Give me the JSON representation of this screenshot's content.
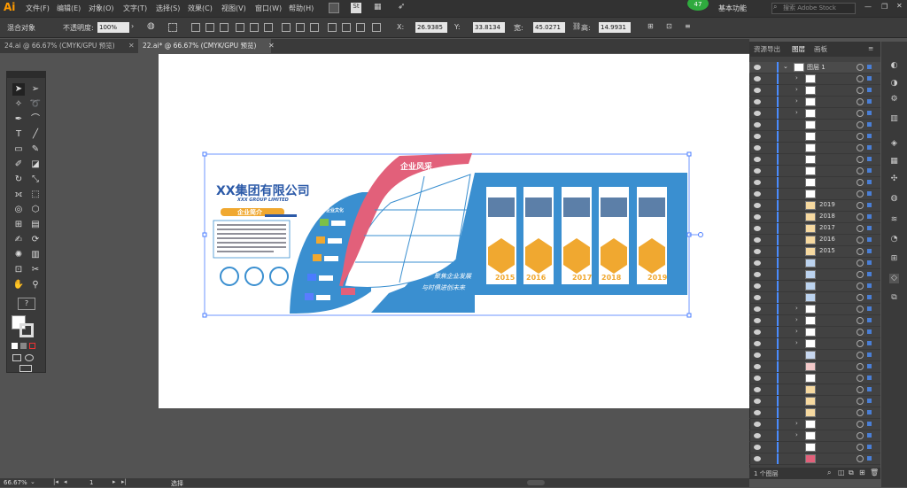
{
  "app": {
    "logo": "Ai"
  },
  "menu": [
    "文件(F)",
    "编辑(E)",
    "对象(O)",
    "文字(T)",
    "选择(S)",
    "效果(C)",
    "视图(V)",
    "窗口(W)",
    "帮助(H)"
  ],
  "header_right": {
    "badge": "47",
    "workspace": "基本功能",
    "search_placeholder": "搜索 Adobe Stock"
  },
  "control": {
    "label": "混合对象",
    "opacity_label": "不透明度:",
    "opacity_value": "100%",
    "x_label": "X:",
    "x_value": "26.9385",
    "y_label": "Y:",
    "y_value": "33.8134",
    "w_label": "宽:",
    "w_value": "45.0271",
    "h_label": "高:",
    "h_value": "14.9931"
  },
  "tabs": [
    "24.ai @ 66.67% (CMYK/GPU 预览)",
    "22.ai* @ 66.67% (CMYK/GPU 预览)"
  ],
  "panel": {
    "tabs": [
      "资源导出",
      "图层",
      "画板"
    ],
    "top_layer": "图层 1",
    "layer_years": [
      "2019",
      "2018",
      "2017",
      "2016",
      "2015"
    ],
    "footer": "1 个图层"
  },
  "status": {
    "zoom": "66.67%",
    "page": "1",
    "mode": "选择"
  },
  "artwork": {
    "company": "XX集团有限公司",
    "company_en": "XXX GROUP LIMITED",
    "intro": "企业简介",
    "feature_title": "企业风采",
    "culture": "企业文化",
    "years": [
      "2015",
      "2016",
      "2017",
      "2018",
      "2019"
    ],
    "slogan1": "聚焦企业发展",
    "slogan2": "与时俱进创未来"
  },
  "colors": {
    "accent_blue": "#3a8fd0",
    "accent_pink": "#e2607a",
    "accent_orange": "#f0a830",
    "selection": "#4a7cff"
  }
}
